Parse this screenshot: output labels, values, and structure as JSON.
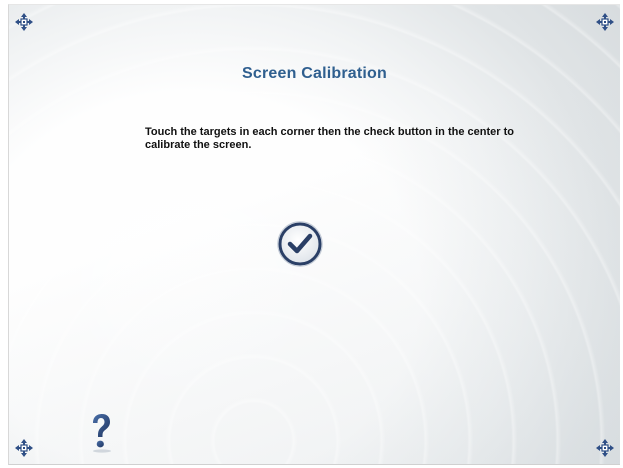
{
  "calibration": {
    "title": "Screen Calibration",
    "instructions": "Touch the targets in each corner then the check button in the center to calibrate the screen."
  },
  "icons": {
    "targets": [
      "calibration-target-icon",
      "calibration-target-icon",
      "calibration-target-icon",
      "calibration-target-icon"
    ],
    "check": "check-circle-icon",
    "help": "question-mark-icon"
  },
  "colors": {
    "title": "#2f5f8f",
    "target": "#2f4f86",
    "check": "#2a3f66"
  }
}
